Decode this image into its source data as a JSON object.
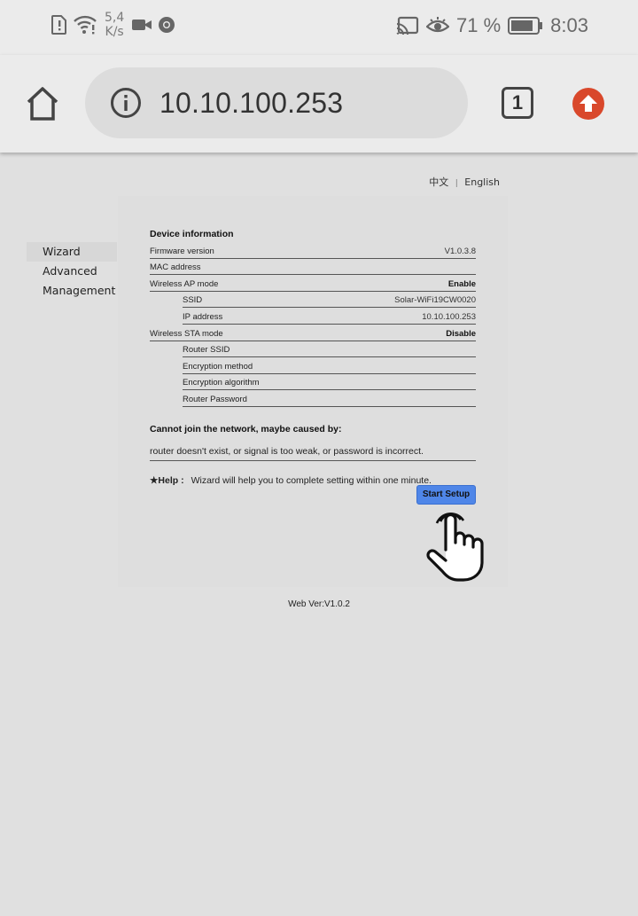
{
  "status_bar": {
    "speed_value": "5,4",
    "speed_unit": "K/s",
    "battery_percent": "71 %",
    "time": "8:03",
    "icons": [
      "sim-alert-icon",
      "wifi-alert-icon",
      "video-camera-icon",
      "chrome-icon",
      "cast-icon",
      "eye-icon",
      "battery-icon"
    ]
  },
  "browser": {
    "url": "10.10.100.253",
    "tab_count": "1",
    "icons": [
      "home-icon",
      "info-icon",
      "tabs-icon",
      "upload-icon"
    ]
  },
  "language": {
    "chinese": "中文",
    "separator": "|",
    "english": "English"
  },
  "sidebar": {
    "items": [
      {
        "label": "Wizard",
        "active": true
      },
      {
        "label": "Advanced",
        "active": false
      },
      {
        "label": "Management",
        "active": false
      }
    ]
  },
  "device_info": {
    "title": "Device information",
    "rows": [
      {
        "label": "Firmware version",
        "value": "V1.0.3.8"
      },
      {
        "label": "MAC address",
        "value": ""
      },
      {
        "label": "Wireless AP mode",
        "value": "Enable"
      },
      {
        "label": "SSID",
        "value": "Solar-WiFi19CW0020"
      },
      {
        "label": "IP address",
        "value": "10.10.100.253"
      },
      {
        "label": "Wireless STA mode",
        "value": "Disable"
      },
      {
        "label": "Router SSID",
        "value": ""
      },
      {
        "label": "Encryption method",
        "value": ""
      },
      {
        "label": "Encryption algorithm",
        "value": ""
      },
      {
        "label": "Router Password",
        "value": ""
      }
    ]
  },
  "failure": {
    "title": "Cannot join the network,  maybe caused by:",
    "description": "router doesn't exist,  or signal is too weak,  or password is incorrect."
  },
  "help": {
    "label": "★Help :",
    "text": "Wizard will help you to complete setting within one minute."
  },
  "start_button": "Start Setup",
  "web_version": "Web Ver:V1.0.2",
  "colors": {
    "accent_button": "#4f86e8",
    "upload_button": "#d9482b",
    "page_background": "#e0e0e0"
  }
}
